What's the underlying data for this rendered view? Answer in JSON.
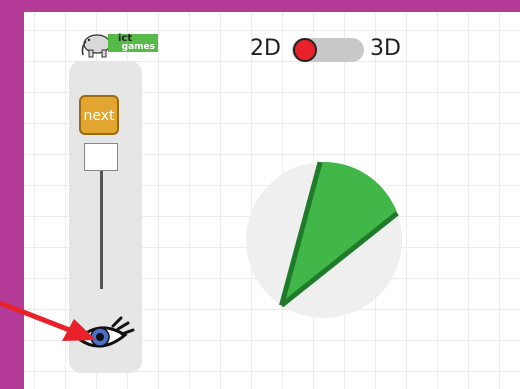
{
  "logo": {
    "line1": "ict",
    "line2": "games"
  },
  "toggle": {
    "left_label": "2D",
    "right_label": "3D",
    "state": "2D"
  },
  "panel": {
    "next_label": "next",
    "slider_value": 0
  },
  "pie": {
    "fraction_shown": 0.12,
    "colors": {
      "base": "#efefef",
      "slice": "#41b649",
      "edge": "#1f7a2a"
    }
  },
  "annotation": {
    "arrow_color": "#e8212a",
    "points_to": "eye-button"
  }
}
